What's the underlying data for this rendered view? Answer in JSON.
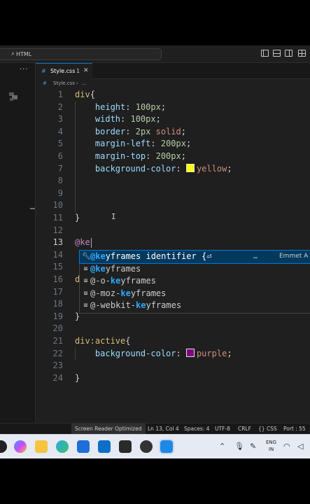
{
  "titlebar": {
    "search_text": "HTML"
  },
  "sidebar": {
    "more_label": "···"
  },
  "tab": {
    "name": "Style.css",
    "modified_count": "1",
    "close": "✕"
  },
  "breadcrumb": {
    "file": "Style.css",
    "separator": "›",
    "more": "..."
  },
  "editor": {
    "lines": [
      {
        "n": "1"
      },
      {
        "n": "2"
      },
      {
        "n": "3"
      },
      {
        "n": "4"
      },
      {
        "n": "5"
      },
      {
        "n": "6"
      },
      {
        "n": "7"
      },
      {
        "n": "8"
      },
      {
        "n": "9"
      },
      {
        "n": "10"
      },
      {
        "n": "11"
      },
      {
        "n": "12"
      },
      {
        "n": "13"
      },
      {
        "n": "14"
      },
      {
        "n": "15"
      },
      {
        "n": "16"
      },
      {
        "n": "17"
      },
      {
        "n": "18"
      },
      {
        "n": "19"
      },
      {
        "n": "20"
      },
      {
        "n": "21"
      },
      {
        "n": "22"
      },
      {
        "n": "23"
      },
      {
        "n": "24"
      }
    ],
    "code": {
      "l1_sel": "div",
      "l1_brace": "{",
      "l2_prop": "height",
      "l2_val": "100px",
      "l3_prop": "width",
      "l3_val": "100px",
      "l4_prop": "border",
      "l4_num": "2px",
      "l4_val": "solid",
      "l5_prop": "margin-left",
      "l5_val": "200px",
      "l6_prop": "margin-top",
      "l6_val": "200px",
      "l7_prop": "background-color",
      "l7_val": "yellow",
      "l11_brace": "}",
      "l13_text": "@ke",
      "l16_partial": "d",
      "l19_brace": "}",
      "l21_sel": "div:active",
      "l21_brace": "{",
      "l22_prop": "background-color",
      "l22_val": "purple",
      "l24_brace": "}"
    },
    "colors": {
      "yellow": "#ffff00",
      "purple": "#800080"
    }
  },
  "suggest": {
    "items": [
      {
        "pre": "",
        "hl": "@ke",
        "post": "yframes identifier {⏎",
        "icon": "wrench-icon"
      },
      {
        "pre": "",
        "hl": "@ke",
        "post": "yframes",
        "icon": "keyword-icon"
      },
      {
        "pre": "@-o-",
        "hl": "ke",
        "post": "yframes",
        "icon": "keyword-icon"
      },
      {
        "pre": "@-moz-",
        "hl": "ke",
        "post": "yframes",
        "icon": "keyword-icon"
      },
      {
        "pre": "@-webkit-",
        "hl": "ke",
        "post": "yframes",
        "icon": "keyword-icon"
      }
    ],
    "more": "…",
    "detail": "Emmet A"
  },
  "statusbar": {
    "screen_reader": "Screen Reader Optimized",
    "position": "Ln 13, Col 4",
    "spaces": "Spaces: 4",
    "encoding": "UTF-8",
    "eol": "CRLF",
    "language": "CSS",
    "port": "Port : 55"
  },
  "taskbar": {
    "lang_top": "ENG",
    "lang_bottom": "IN"
  }
}
